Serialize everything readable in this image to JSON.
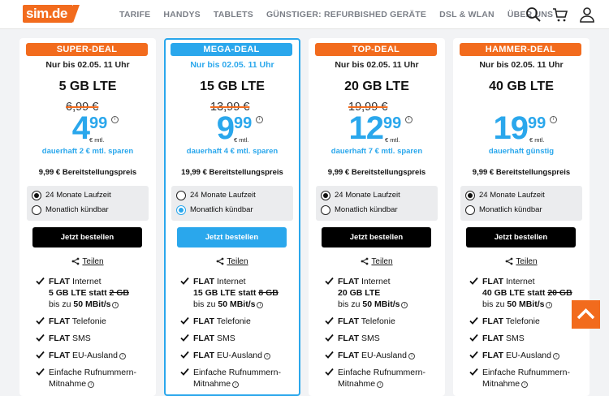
{
  "header": {
    "logo": "sim.de",
    "nav": [
      "TARIFE",
      "HANDYS",
      "TABLETS",
      "GÜNSTIGER: REFURBISHED GERÄTE",
      "DSL & WLAN",
      "ÜBER UNS"
    ],
    "icons": [
      "search-icon",
      "cart-icon",
      "user-icon"
    ]
  },
  "cards": [
    {
      "badge": "SUPER-DEAL",
      "until": "Nur bis 02.05. 11 Uhr",
      "data": "5 GB LTE",
      "old_price": "6,99 €",
      "price_main": "4",
      "price_cents": "99",
      "unit": "€ mtl.",
      "save": "dauerhaft 2 € mtl. sparen",
      "setup": "9,99 € Bereitstellungspreis",
      "option1": "24 Monate Laufzeit",
      "option2": "Monatlich kündbar",
      "selected": 1,
      "order": "Jetzt bestellen",
      "share": "Teilen",
      "f1a": "FLAT",
      "f1b": " Internet",
      "f1c": "5 GB LTE statt ",
      "f1d": "2 GB",
      "f1e": "bis zu ",
      "f1f": "50 MBit/s",
      "f2a": "FLAT",
      "f2b": " Telefonie",
      "f3a": "FLAT",
      "f3b": " SMS",
      "f4a": "FLAT",
      "f4b": " EU-Ausland",
      "f5a": "Einfache Rufnummern-",
      "f5b": "Mitnahme"
    },
    {
      "badge": "MEGA-DEAL",
      "until": "Nur bis 02.05. 11 Uhr",
      "data": "15 GB LTE",
      "old_price": "13,99 €",
      "price_main": "9",
      "price_cents": "99",
      "unit": "€ mtl.",
      "save": "dauerhaft 4 € mtl. sparen",
      "setup": "19,99 € Bereitstellungspreis",
      "option1": "24 Monate Laufzeit",
      "option2": "Monatlich kündbar",
      "selected": 2,
      "order": "Jetzt bestellen",
      "share": "Teilen",
      "f1a": "FLAT",
      "f1b": " Internet",
      "f1c": "15 GB LTE statt ",
      "f1d": "8 GB",
      "f1e": "bis zu ",
      "f1f": "50 MBit/s",
      "f2a": "FLAT",
      "f2b": " Telefonie",
      "f3a": "FLAT",
      "f3b": " SMS",
      "f4a": "FLAT",
      "f4b": " EU-Ausland",
      "f5a": "Einfache Rufnummern-",
      "f5b": "Mitnahme"
    },
    {
      "badge": "TOP-DEAL",
      "until": "Nur bis 02.05. 11 Uhr",
      "data": "20 GB LTE",
      "old_price": "19,99 €",
      "price_main": "12",
      "price_cents": "99",
      "unit": "€ mtl.",
      "save": "dauerhaft 7 € mtl. sparen",
      "setup": "9,99 € Bereitstellungspreis",
      "option1": "24 Monate Laufzeit",
      "option2": "Monatlich kündbar",
      "selected": 1,
      "order": "Jetzt bestellen",
      "share": "Teilen",
      "f1a": "FLAT",
      "f1b": " Internet",
      "f1c": "20 GB LTE",
      "f1d": "",
      "f1e": "bis zu ",
      "f1f": "50 MBit/s",
      "f2a": "FLAT",
      "f2b": " Telefonie",
      "f3a": "FLAT",
      "f3b": " SMS",
      "f4a": "FLAT",
      "f4b": " EU-Ausland",
      "f5a": "Einfache Rufnummern-",
      "f5b": "Mitnahme"
    },
    {
      "badge": "HAMMER-DEAL",
      "until": "Nur bis 02.05. 11 Uhr",
      "data": "40 GB LTE",
      "old_price": "",
      "price_main": "19",
      "price_cents": "99",
      "unit": "€ mtl.",
      "save": "dauerhaft günstig",
      "setup": "9,99 € Bereitstellungspreis",
      "option1": "24 Monate Laufzeit",
      "option2": "Monatlich kündbar",
      "selected": 1,
      "order": "Jetzt bestellen",
      "share": "Teilen",
      "f1a": "FLAT",
      "f1b": " Internet",
      "f1c": "40 GB LTE statt ",
      "f1d": "20 GB",
      "f1e": "bis zu ",
      "f1f": "50 MBit/s",
      "f2a": "FLAT",
      "f2b": " Telefonie",
      "f3a": "FLAT",
      "f3b": " SMS",
      "f4a": "FLAT",
      "f4b": " EU-Ausland",
      "f5a": "Einfache Rufnummern-",
      "f5b": "Mitnahme"
    }
  ],
  "colors": {
    "brand_orange": "#f26b1d",
    "accent_blue": "#2aa7ec"
  },
  "back_to_top": "arrow-up-icon"
}
